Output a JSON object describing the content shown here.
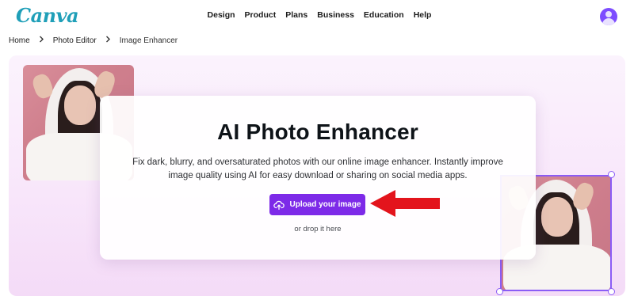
{
  "brand": {
    "logo_text": "Canva"
  },
  "nav": {
    "items": [
      {
        "label": "Design"
      },
      {
        "label": "Product"
      },
      {
        "label": "Plans"
      },
      {
        "label": "Business"
      },
      {
        "label": "Education"
      },
      {
        "label": "Help"
      }
    ]
  },
  "breadcrumb": {
    "items": [
      {
        "label": "Home"
      },
      {
        "label": "Photo Editor"
      },
      {
        "label": "Image Enhancer"
      }
    ],
    "separator": "›"
  },
  "hero": {
    "title": "AI Photo Enhancer",
    "description": "Fix dark, blurry, and oversaturated photos with our online image enhancer. Instantly improve image quality using AI for easy download or sharing on social media apps.",
    "upload_label": "Upload your image",
    "drop_label": "or drop it here"
  },
  "colors": {
    "brand_purple": "#7d2ae8",
    "selection_border": "#8b5cf6",
    "annotation_arrow": "#e3141c"
  },
  "icons": {
    "upload": "cloud-upload-icon",
    "avatar": "user-avatar-icon",
    "separator": "chevron-right-icon"
  }
}
